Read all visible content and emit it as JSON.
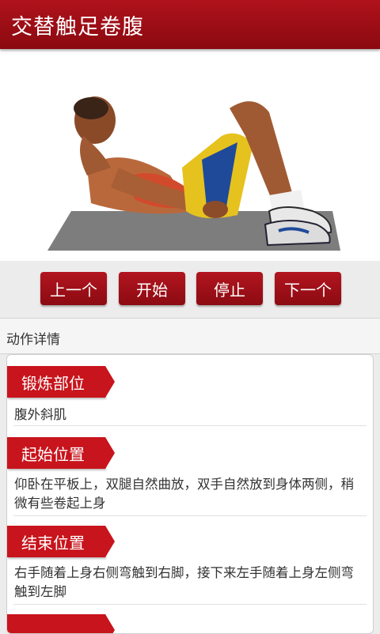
{
  "header": {
    "title": "交替触足卷腹"
  },
  "illustration": {
    "alt": "exercise-illustration"
  },
  "controls": {
    "prev_label": "上一个",
    "start_label": "开始",
    "stop_label": "停止",
    "next_label": "下一个"
  },
  "section": {
    "title": "动作详情"
  },
  "details": [
    {
      "tag": "锻炼部位",
      "text": "腹外斜肌"
    },
    {
      "tag": "起始位置",
      "text": "仰卧在平板上，双腿自然曲放，双手自然放到身体两侧，稍微有些卷起上身"
    },
    {
      "tag": "结束位置",
      "text": "右手随着上身右侧弯触到右脚，接下来左手随着上身左侧弯触到左脚"
    }
  ],
  "colors": {
    "brand": "#a30f18",
    "tag": "#c8141c"
  }
}
